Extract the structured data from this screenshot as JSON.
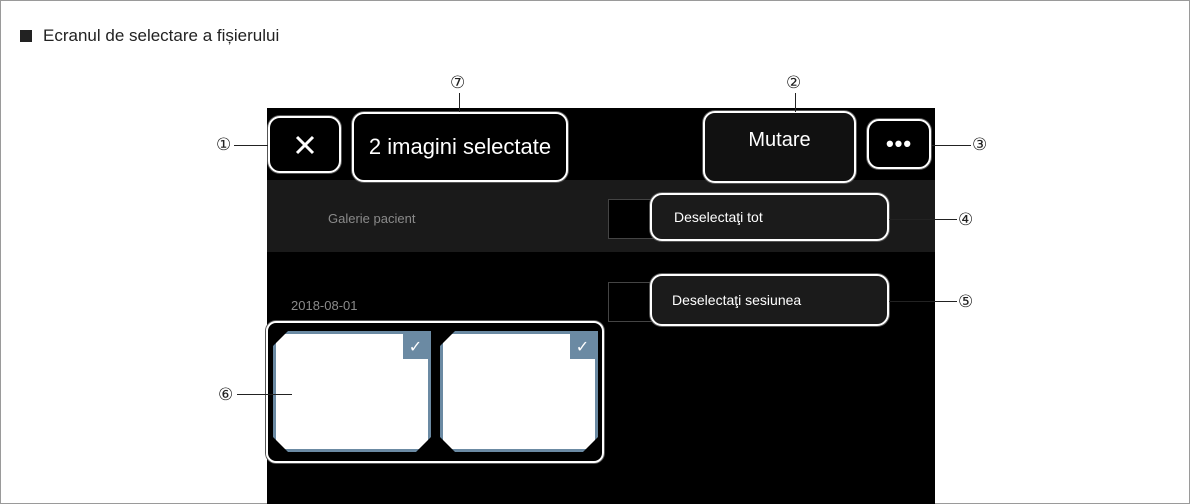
{
  "heading": "Ecranul de selectare a fișierului",
  "toolbar": {
    "selection_title": "2 imagini selectate",
    "move_label": "Mutare",
    "more_label": "•••"
  },
  "gallery_label": "Galerie pacient",
  "menu": {
    "deselect_all": "Deselectaţi tot",
    "deselect_session": "Deselectaţi sesiunea"
  },
  "session_date": "2018-08-01",
  "thumbnails": [
    {
      "selected": true,
      "check": "✓"
    },
    {
      "selected": true,
      "check": "✓"
    }
  ],
  "callouts": [
    "①",
    "②",
    "③",
    "④",
    "⑤",
    "⑥",
    "⑦"
  ]
}
